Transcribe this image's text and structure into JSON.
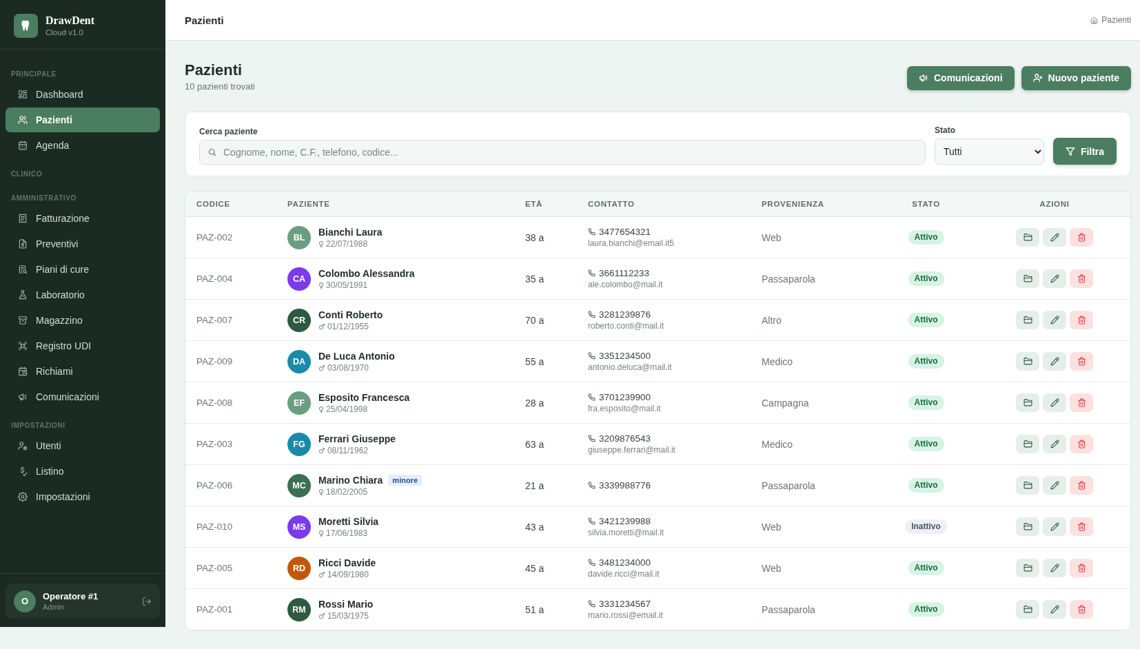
{
  "sidebar": {
    "brand": {
      "name": "DrawDent",
      "version": "Cloud v1.0"
    },
    "sections": [
      {
        "title": "PRINCIPALE",
        "items": [
          {
            "label": "Dashboard",
            "selected": false
          },
          {
            "label": "Pazienti",
            "selected": true
          },
          {
            "label": "Agenda",
            "selected": false
          }
        ]
      },
      {
        "title": "CLINICO"
      },
      {
        "title": "AMMINISTRATIVO",
        "items": [
          {
            "label": "Fatturazione",
            "selected": false
          },
          {
            "label": "Preventivi",
            "selected": false
          },
          {
            "label": "Piani di cure",
            "selected": false
          },
          {
            "label": "Laboratorio",
            "selected": false
          },
          {
            "label": "Magazzino",
            "selected": false
          },
          {
            "label": "Registro UDI",
            "selected": false
          },
          {
            "label": "Richiami",
            "selected": false
          },
          {
            "label": "Comunicazioni",
            "selected": false
          }
        ]
      },
      {
        "title": "IMPOSTAZIONI",
        "items": [
          {
            "label": "Utenti",
            "selected": false
          },
          {
            "label": "Listino",
            "selected": false
          },
          {
            "label": "Impostazioni",
            "selected": false
          }
        ]
      }
    ],
    "user": {
      "initial": "O",
      "name": "Operatore #1",
      "role": "Admin"
    }
  },
  "header": {
    "title": "Pazienti",
    "breadcrumb": "Pazienti"
  },
  "page": {
    "title": "Pazienti",
    "subtitle": "10 pazienti trovati",
    "actions": [
      {
        "label": "Comunicazioni"
      },
      {
        "label": "Nuovo paziente"
      }
    ]
  },
  "filters": {
    "search": {
      "label": "Cerca paziente",
      "placeholder": "Cognome, nome, C.F., telefono, codice..."
    },
    "status": {
      "label": "Stato",
      "value": "Tutti"
    },
    "button": "Filtra"
  },
  "table": {
    "columns": [
      "CODICE",
      "PAZIENTE",
      "ETÀ",
      "CONTATTO",
      "PROVENIENZA",
      "STATO",
      "AZIONI"
    ],
    "rows": [
      {
        "code": "PAZ-002",
        "initials": "BL",
        "color": "#6b9e80",
        "name": "Bianchi Laura",
        "sex": "♀",
        "birth": "22/07/1988",
        "age": "38 a",
        "phone": "3477654321",
        "email": "laura.bianchi@email.it5",
        "source": "Web",
        "status": "Attivo",
        "active": true
      },
      {
        "code": "PAZ-004",
        "initials": "CA",
        "color": "#7c3aed",
        "name": "Colombo Alessandra",
        "sex": "♀",
        "birth": "30/05/1991",
        "age": "35 a",
        "phone": "3661112233",
        "email": "ale.colombo@mail.it",
        "source": "Passaparola",
        "status": "Attivo",
        "active": true
      },
      {
        "code": "PAZ-007",
        "initials": "CR",
        "color": "#2d5a40",
        "name": "Conti Roberto",
        "sex": "♂",
        "birth": "01/12/1955",
        "age": "70 a",
        "phone": "3281239876",
        "email": "roberto.conti@mail.it",
        "source": "Altro",
        "status": "Attivo",
        "active": true
      },
      {
        "code": "PAZ-009",
        "initials": "DA",
        "color": "#1a8aa8",
        "name": "De Luca Antonio",
        "sex": "♂",
        "birth": "03/08/1970",
        "age": "55 a",
        "phone": "3351234500",
        "email": "antonio.deluca@mail.it",
        "source": "Medico",
        "status": "Attivo",
        "active": true
      },
      {
        "code": "PAZ-008",
        "initials": "EF",
        "color": "#6b9e80",
        "name": "Esposito Francesca",
        "sex": "♀",
        "birth": "25/04/1998",
        "age": "28 a",
        "phone": "3701239900",
        "email": "fra.esposito@mail.it",
        "source": "Campagna",
        "status": "Attivo",
        "active": true
      },
      {
        "code": "PAZ-003",
        "initials": "FG",
        "color": "#1a8aa8",
        "name": "Ferrari Giuseppe",
        "sex": "♂",
        "birth": "08/11/1962",
        "age": "63 a",
        "phone": "3209876543",
        "email": "giuseppe.ferrari@mail.it",
        "source": "Medico",
        "status": "Attivo",
        "active": true
      },
      {
        "code": "PAZ-006",
        "initials": "MC",
        "color": "#3d6e55",
        "name": "Marino Chiara",
        "badge": "minore",
        "sex": "♀",
        "birth": "18/02/2005",
        "age": "21 a",
        "phone": "3339988776",
        "source": "Passaparola",
        "status": "Attivo",
        "active": true
      },
      {
        "code": "PAZ-010",
        "initials": "MS",
        "color": "#7c3aed",
        "name": "Moretti Silvia",
        "sex": "♀",
        "birth": "17/06/1983",
        "age": "43 a",
        "phone": "3421239988",
        "email": "silvia.moretti@mail.it",
        "source": "Web",
        "status": "Inattivo",
        "active": false
      },
      {
        "code": "PAZ-005",
        "initials": "RD",
        "color": "#c2570c",
        "name": "Ricci Davide",
        "sex": "♂",
        "birth": "14/09/1980",
        "age": "45 a",
        "phone": "3481234000",
        "email": "davide.ricci@mail.it",
        "source": "Web",
        "status": "Attivo",
        "active": true
      },
      {
        "code": "PAZ-001",
        "initials": "RM",
        "color": "#2d5a40",
        "name": "Rossi Mario",
        "sex": "♂",
        "birth": "15/03/1975",
        "age": "51 a",
        "phone": "3331234567",
        "email": "mario.rossi@email.it",
        "source": "Passaparola",
        "status": "Attivo",
        "active": true
      }
    ]
  }
}
